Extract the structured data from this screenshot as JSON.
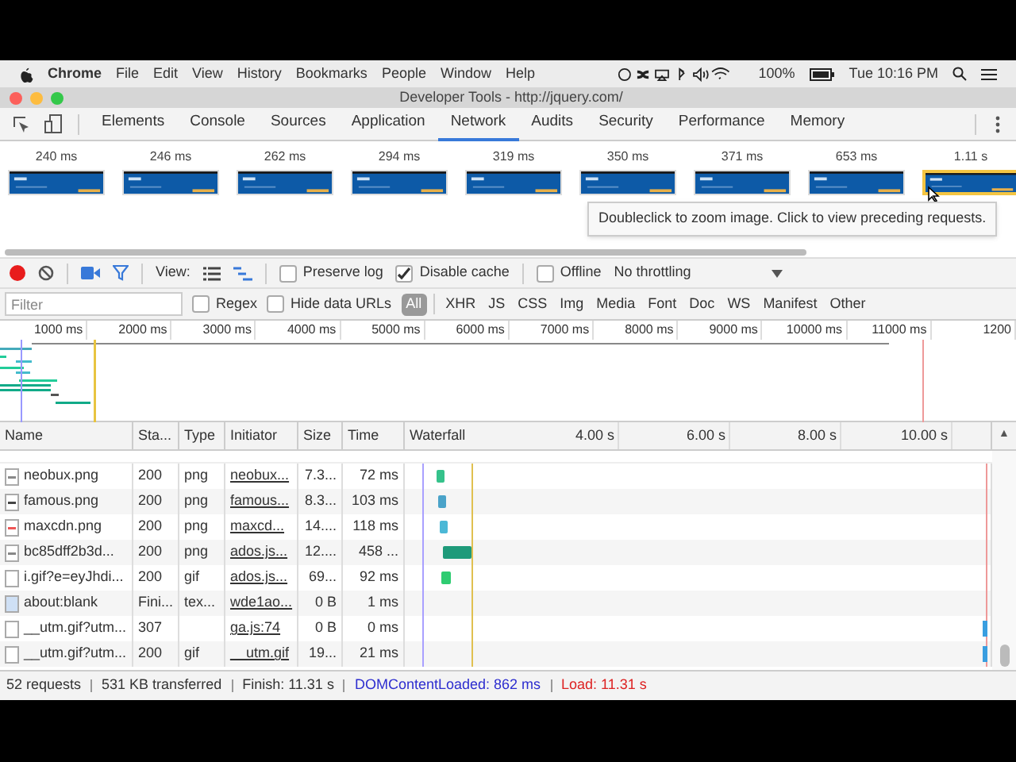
{
  "menubar": {
    "app": "Chrome",
    "items": [
      "File",
      "Edit",
      "View",
      "History",
      "Bookmarks",
      "People",
      "Window",
      "Help"
    ],
    "battery": "100%",
    "clock": "Tue 10:16 PM"
  },
  "window": {
    "title": "Developer Tools - http://jquery.com/"
  },
  "tabs": [
    {
      "label": "Elements",
      "selected": false
    },
    {
      "label": "Console",
      "selected": false
    },
    {
      "label": "Sources",
      "selected": false
    },
    {
      "label": "Application",
      "selected": false
    },
    {
      "label": "Network",
      "selected": true
    },
    {
      "label": "Audits",
      "selected": false
    },
    {
      "label": "Security",
      "selected": false
    },
    {
      "label": "Performance",
      "selected": false
    },
    {
      "label": "Memory",
      "selected": false
    }
  ],
  "filmstrip": [
    {
      "time": "240 ms",
      "selected": false
    },
    {
      "time": "246 ms",
      "selected": false
    },
    {
      "time": "262 ms",
      "selected": false
    },
    {
      "time": "294 ms",
      "selected": false
    },
    {
      "time": "319 ms",
      "selected": false
    },
    {
      "time": "350 ms",
      "selected": false
    },
    {
      "time": "371 ms",
      "selected": false
    },
    {
      "time": "653 ms",
      "selected": false
    },
    {
      "time": "1.11 s",
      "selected": true
    }
  ],
  "tooltip": "Doubleclick to zoom image. Click to view preceding requests.",
  "toolbar": {
    "recording": true,
    "view_label": "View:",
    "checkboxes": [
      {
        "label": "Preserve log",
        "checked": false
      },
      {
        "label": "Disable cache",
        "checked": true
      },
      {
        "label": "Offline",
        "checked": false
      }
    ],
    "throttling": "No throttling"
  },
  "filter": {
    "placeholder": "Filter",
    "checkboxes": [
      {
        "label": "Regex",
        "checked": false
      },
      {
        "label": "Hide data URLs",
        "checked": false
      }
    ],
    "types": [
      {
        "label": "All",
        "selected": true
      },
      {
        "label": "XHR",
        "selected": false
      },
      {
        "label": "JS",
        "selected": false
      },
      {
        "label": "CSS",
        "selected": false
      },
      {
        "label": "Img",
        "selected": false
      },
      {
        "label": "Media",
        "selected": false
      },
      {
        "label": "Font",
        "selected": false
      },
      {
        "label": "Doc",
        "selected": false
      },
      {
        "label": "WS",
        "selected": false
      },
      {
        "label": "Manifest",
        "selected": false
      },
      {
        "label": "Other",
        "selected": false
      }
    ]
  },
  "overview_ticks": [
    "1000 ms",
    "2000 ms",
    "3000 ms",
    "4000 ms",
    "5000 ms",
    "6000 ms",
    "7000 ms",
    "8000 ms",
    "9000 ms",
    "10000 ms",
    "11000 ms",
    "1200"
  ],
  "table": {
    "columns": [
      "Name",
      "Sta...",
      "Type",
      "Initiator",
      "Size",
      "Time"
    ],
    "waterfall_header": "Waterfall",
    "waterfall_ticks": [
      "4.00 s",
      "6.00 s",
      "8.00 s",
      "10.00 s"
    ],
    "sort_mark": "▲",
    "rows": [
      {
        "name": "neobux.png",
        "status": "200",
        "type": "png",
        "initiator": "neobux...",
        "size": "7.3...",
        "time": "72 ms"
      },
      {
        "name": "famous.png",
        "status": "200",
        "type": "png",
        "initiator": "famous...",
        "size": "8.3...",
        "time": "103 ms"
      },
      {
        "name": "maxcdn.png",
        "status": "200",
        "type": "png",
        "initiator": "maxcd...",
        "size": "14....",
        "time": "118 ms"
      },
      {
        "name": "bc85dff2b3d...",
        "status": "200",
        "type": "png",
        "initiator": "ados.js...",
        "size": "12....",
        "time": "458 ..."
      },
      {
        "name": "i.gif?e=eyJhdi...",
        "status": "200",
        "type": "gif",
        "initiator": "ados.js...",
        "size": "69...",
        "time": "92 ms"
      },
      {
        "name": "about:blank",
        "status": "Fini...",
        "type": "tex...",
        "initiator": "wde1ao...",
        "size": "0 B",
        "time": "1 ms"
      },
      {
        "name": "__utm.gif?utm...",
        "status": "307",
        "type": "",
        "initiator": "ga.js:74",
        "size": "0 B",
        "time": "0 ms"
      },
      {
        "name": "__utm.gif?utm...",
        "status": "200",
        "type": "gif",
        "initiator": "__utm.gif",
        "size": "19...",
        "time": "21 ms"
      }
    ]
  },
  "status_bar": {
    "requests": "52 requests",
    "transferred": "531 KB transferred",
    "finish": "Finish: 11.31 s",
    "dcl": "DOMContentLoaded: 862 ms",
    "load": "Load: 11.31 s"
  }
}
